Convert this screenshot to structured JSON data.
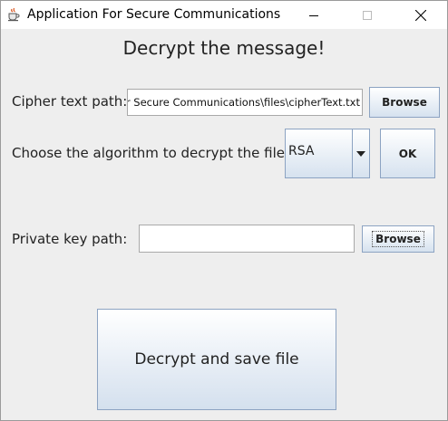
{
  "window": {
    "title": "Application For Secure Communications",
    "icon": "java-cup-icon"
  },
  "main": {
    "heading": "Decrypt the message!",
    "cipher": {
      "label": "Cipher text path:",
      "value": "For Secure Communications\\files\\cipherText.txt",
      "browse_label": "Browse"
    },
    "algorithm": {
      "label": "Choose the algorithm to decrypt the file:",
      "selected": "RSA",
      "ok_label": "OK"
    },
    "private_key": {
      "label": "Private key path:",
      "value": "",
      "browse_label": "Browse"
    },
    "decrypt_button_label": "Decrypt and save file"
  },
  "colors": {
    "background": "#eeeeee",
    "button_border": "#8ca3c2",
    "button_gradient_bottom": "#d6e2ef"
  }
}
